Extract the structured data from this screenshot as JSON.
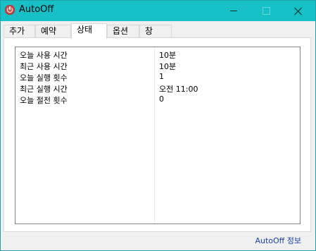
{
  "window": {
    "title": "AutoOff",
    "icon": "power-icon"
  },
  "tabs": [
    {
      "label": "추가",
      "active": false
    },
    {
      "label": "예약",
      "active": false
    },
    {
      "label": "상태",
      "active": true
    },
    {
      "label": "옵션",
      "active": false
    },
    {
      "label": "창",
      "active": false
    }
  ],
  "status": {
    "rows": [
      {
        "label": "오늘 사용 시간",
        "value": "10분"
      },
      {
        "label": "최근 사용 시간",
        "value": "10분"
      },
      {
        "label": "오늘 실행 횟수",
        "value": "1"
      },
      {
        "label": "최근 실행 시간",
        "value": "오전 11:00"
      },
      {
        "label": "오늘 절전 횟수",
        "value": "0"
      }
    ]
  },
  "footer": {
    "about_link": "AutoOff 정보"
  },
  "colors": {
    "titlebar": "#16c0c6",
    "link": "#1a3fa6"
  }
}
